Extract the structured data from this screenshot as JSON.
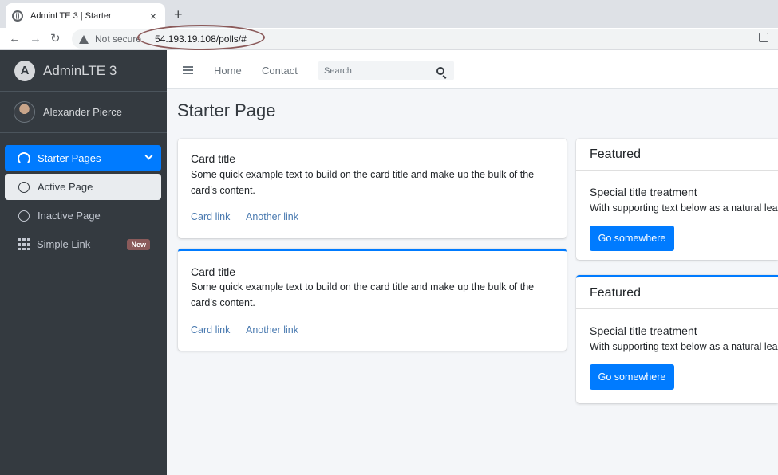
{
  "browser": {
    "tab_title": "AdminLTE 3 | Starter",
    "tab_close": "×",
    "new_tab": "+",
    "back": "←",
    "forward": "→",
    "reload": "↻",
    "security_label": "Not secure",
    "url": "54.193.19.108/polls/#"
  },
  "sidebar": {
    "brand_logo": "A",
    "brand_name": "AdminLTE 3",
    "user_name": "Alexander Pierce",
    "items": [
      {
        "label": "Starter Pages",
        "icon": "tachometer-icon",
        "state": "active-parent"
      },
      {
        "label": "Active Page",
        "icon": "circle-icon",
        "state": "active-child"
      },
      {
        "label": "Inactive Page",
        "icon": "circle-icon",
        "state": "normal"
      },
      {
        "label": "Simple Link",
        "icon": "th-icon",
        "badge": "New",
        "state": "normal"
      }
    ]
  },
  "topnav": {
    "home": "Home",
    "contact": "Contact",
    "search_placeholder": "Search"
  },
  "content": {
    "page_title": "Starter Page",
    "cards": [
      {
        "title": "Card title",
        "text": "Some quick example text to build on the card title and make up the bulk of the card's content.",
        "link1": "Card link",
        "link2": "Another link"
      },
      {
        "title": "Card title",
        "text": "Some quick example text to build on the card title and make up the bulk of the card's content.",
        "link1": "Card link",
        "link2": "Another link"
      }
    ],
    "featured_cards": [
      {
        "header": "Featured",
        "title": "Special title treatment",
        "text": "With supporting text below as a natural lead-in to additional content.",
        "button": "Go somewhere"
      },
      {
        "header": "Featured",
        "title": "Special title treatment",
        "text": "With supporting text below as a natural lead-in to additional content.",
        "button": "Go somewhere"
      }
    ]
  },
  "colors": {
    "primary": "#007bff",
    "sidebar_bg": "#343a40",
    "content_bg": "#f4f6f9",
    "badge": "#8a5a5a",
    "annotation_oval": "#8b5a5a"
  }
}
